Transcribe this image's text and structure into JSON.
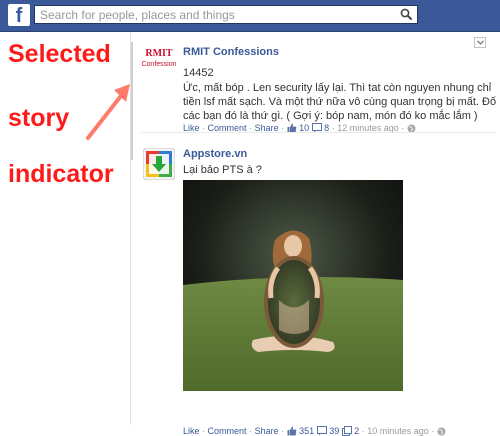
{
  "header": {
    "logo": "f",
    "search_placeholder": "Search for people, places and things",
    "search_icon": "magnifier-icon"
  },
  "annotation": {
    "lines": [
      "Selected",
      "story",
      "indicator"
    ],
    "color": "#ff1a1a"
  },
  "feed": {
    "stories": [
      {
        "author": "RMIT Confessions",
        "avatar_text_1": "RMIT",
        "avatar_text_2": "Confession",
        "text_line_1": "14452",
        "text_line_2": "Ức, mất bóp . Len security lấy lại. Thì tat còn nguyen nhung chỉ",
        "text_line_3": "tiền lsf mất sạch. Và một thứ nữa vô cùng quan trọng bị mất. Đố",
        "text_line_4": "các bạn đó là thứ gì. ( Gợi ý: bóp nam, món đó ko mắc lắm )",
        "like": "Like",
        "comment": "Comment",
        "share": "Share",
        "likes_count": "10",
        "comments_count": "8",
        "time": "12 minutes ago"
      },
      {
        "author": "Appstore.vn",
        "text": "Lại bảo PTS à ?",
        "like": "Like",
        "comment": "Comment",
        "share": "Share",
        "likes_count": "351",
        "comments_count": "39",
        "shares_count": "2",
        "time": "10 minutes ago"
      }
    ]
  }
}
